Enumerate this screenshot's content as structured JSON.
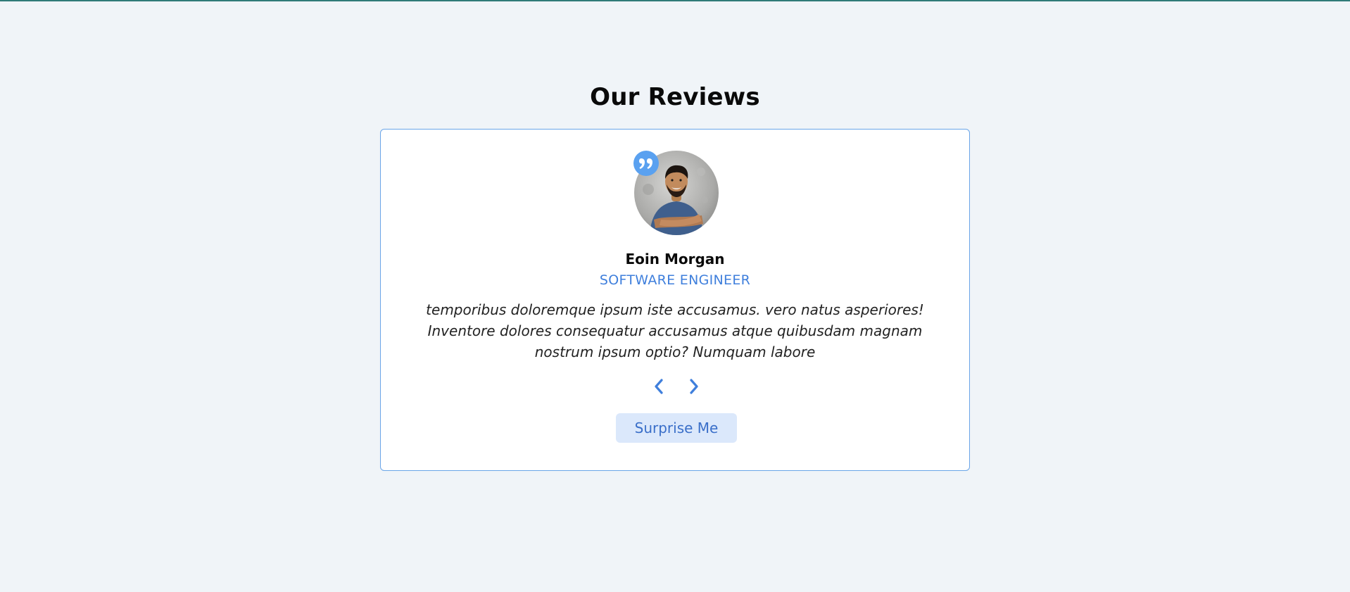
{
  "section": {
    "title": "Our Reviews"
  },
  "review": {
    "name": "Eoin Morgan",
    "job": "SOFTWARE ENGINEER",
    "text": "temporibus doloremque ipsum iste accusamus. vero natus asperiores! Inventore dolores consequatur accusamus atque quibusdam magnam nostrum ipsum optio? Numquam labore",
    "image_alt": "Eoin Morgan"
  },
  "controls": {
    "prev_icon": "chevron-left-icon",
    "next_icon": "chevron-right-icon",
    "random_label": "Surprise Me"
  },
  "icons": {
    "quote": "quote-right-icon"
  },
  "colors": {
    "background": "#f0f4f8",
    "top_border": "#2f7a78",
    "card_border": "#6aa5e8",
    "accent": "#3f7fdc",
    "quote_badge": "#5aa1f0",
    "button_bg": "#dbe8fb",
    "button_text": "#3a6fc9"
  }
}
